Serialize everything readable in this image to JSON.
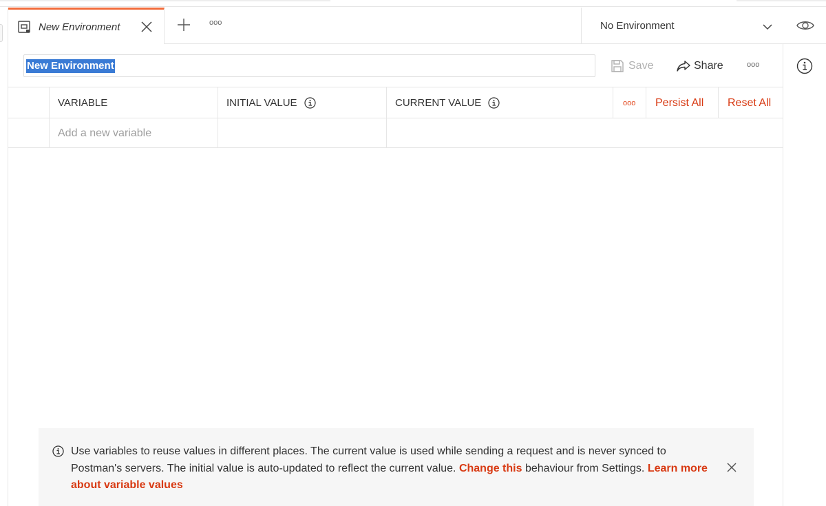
{
  "tab": {
    "title": "New Environment",
    "more_glyph": "ooo"
  },
  "environment_selector": {
    "selected": "No Environment"
  },
  "editor": {
    "name_value": "New Environment",
    "save_label": "Save",
    "share_label": "Share",
    "more_glyph": "ooo"
  },
  "table": {
    "columns": {
      "variable": "VARIABLE",
      "initial_value": "INITIAL VALUE",
      "current_value": "CURRENT VALUE"
    },
    "more_glyph": "ooo",
    "persist_all": "Persist All",
    "reset_all": "Reset All",
    "new_variable_placeholder": "Add a new variable"
  },
  "info_banner": {
    "text_1": "Use variables to reuse values in different places. The current value is used while sending a request and is never synced to Postman's servers. The initial value is auto-updated to reflect the current value. ",
    "link_change": "Change this",
    "text_2": " behaviour from Settings. ",
    "link_learn": "Learn more about variable values"
  },
  "icons": {
    "tab_icon": "environment-icon",
    "close": "close-icon",
    "add": "plus-icon",
    "chevron": "chevron-down-icon",
    "eye": "eye-icon",
    "info": "info-icon",
    "save": "save-icon",
    "share": "share-icon"
  },
  "colors": {
    "accent": "#f26b3a",
    "link": "#d83a13",
    "selection": "#3a7bd5"
  }
}
